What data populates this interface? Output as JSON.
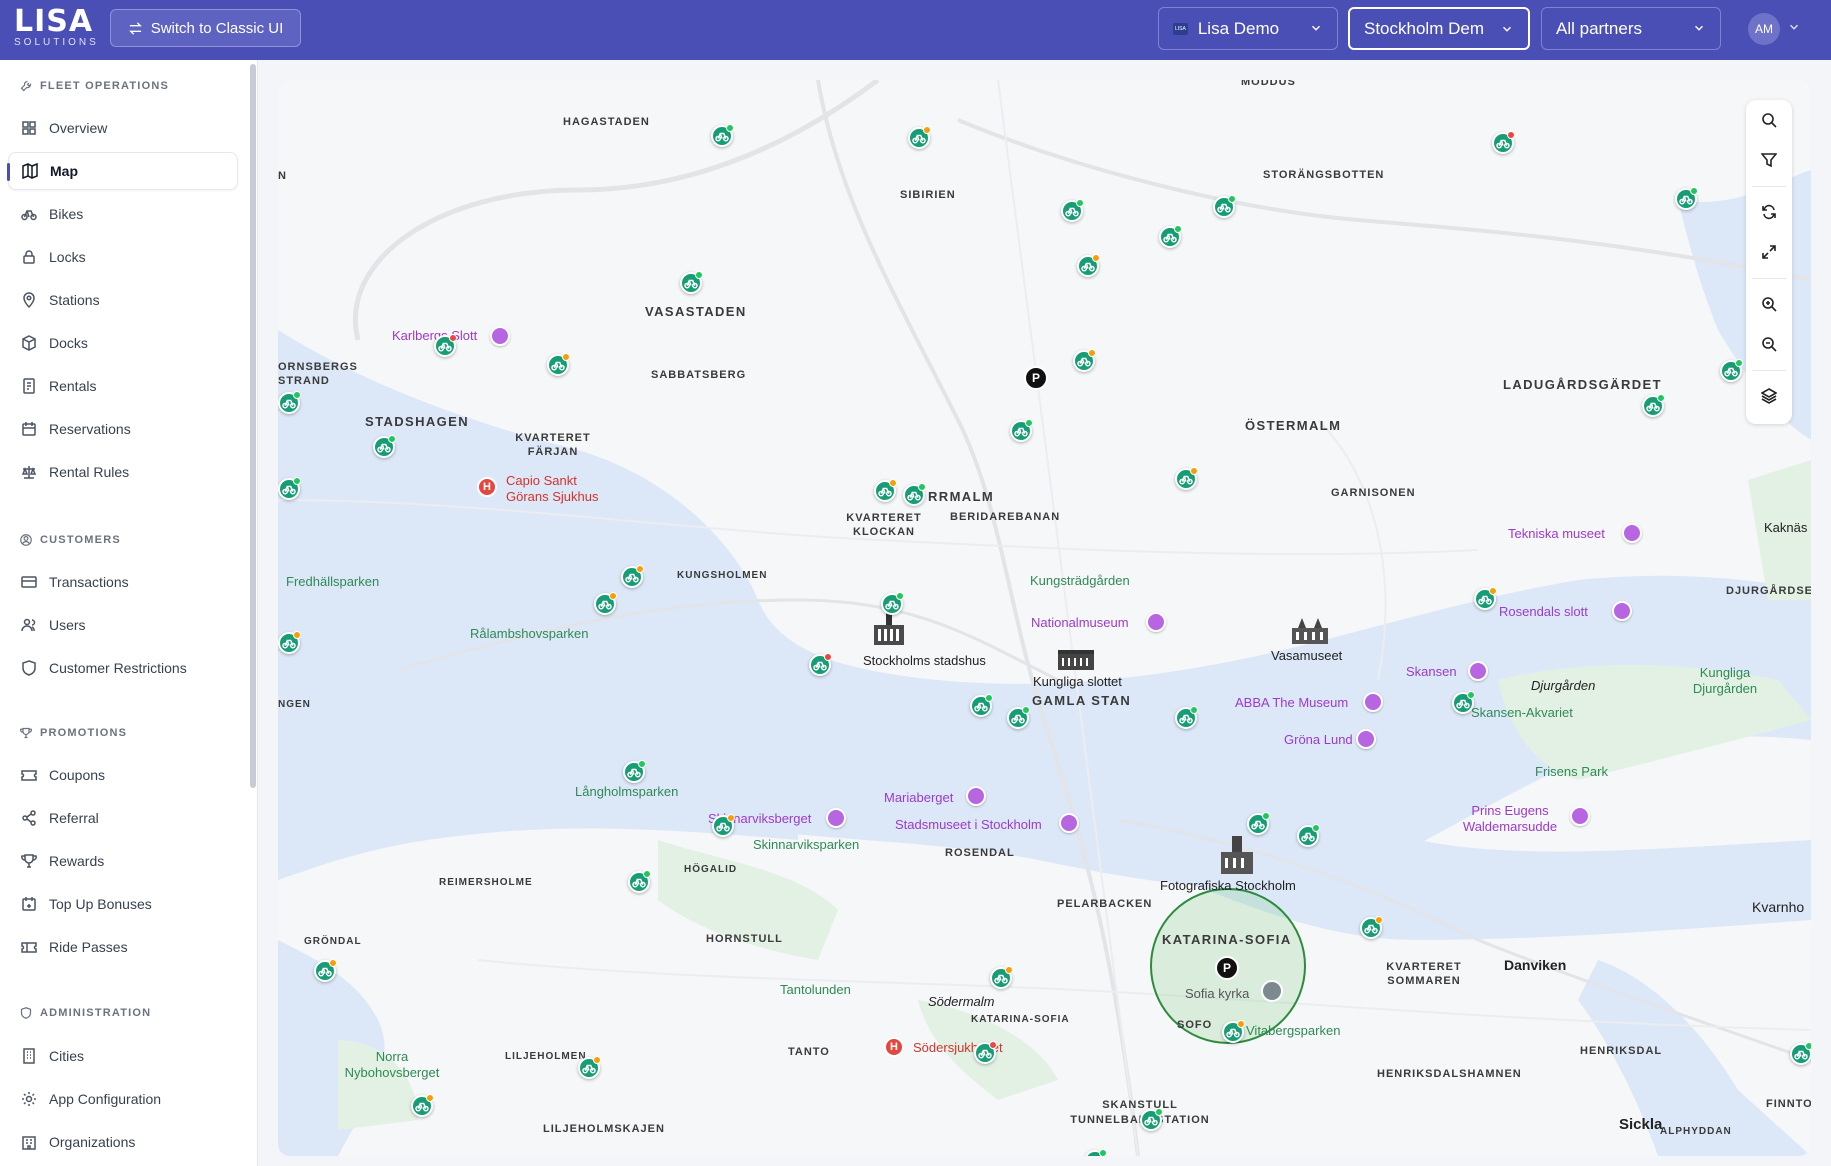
{
  "header": {
    "logo_main": "LISA",
    "logo_sub": "SOLUTIONS",
    "classic_button": "Switch to Classic UI",
    "org_select": {
      "value": "Lisa Demo",
      "badge": "LISA"
    },
    "city_select": {
      "value": "Stockholm Dem"
    },
    "partner_select": {
      "value": "All partners"
    },
    "avatar": "AM"
  },
  "sidebar": {
    "fleet_operations": "FLEET OPERATIONS",
    "fleet_items": [
      "Overview",
      "Map",
      "Bikes",
      "Locks",
      "Stations",
      "Docks",
      "Rentals",
      "Reservations",
      "Rental Rules"
    ],
    "customers": "CUSTOMERS",
    "customer_items": [
      "Transactions",
      "Users",
      "Customer Restrictions"
    ],
    "promotions": "PROMOTIONS",
    "promotion_items": [
      "Coupons",
      "Referral",
      "Rewards",
      "Top Up Bonuses",
      "Ride Passes"
    ],
    "administration": "ADMINISTRATION",
    "admin_items": [
      "Cities",
      "App Configuration",
      "Organizations"
    ],
    "active_item": "Map"
  },
  "map": {
    "districts": [
      "MODDUS",
      "HAGASTADEN",
      "SIBIRIEN",
      "STORÄNGSBOTTEN",
      "N",
      "VASASTADEN",
      "SABBATSBERG",
      "LADUGÅRDSGÄRDET",
      "ORNSBERGS STRAND",
      "STADSHAGEN",
      "KVARTERET FÄRJAN",
      "ÖSTERMALM",
      "RRMALM",
      "BERIDAREBANAN",
      "KVARTERET KLOCKAN",
      "GARNISONEN",
      "KUNGSHOLMEN",
      "DJURGÅRDSE",
      "GAMLA STAN",
      "NGEN",
      "ROSENDAL",
      "REIMERSHOLME",
      "HÖGALID",
      "PELARBACKEN",
      "KATARINA-SOFIA",
      "GRÖNDAL",
      "HORNSTULL",
      "KVARTERET SOMMAREN",
      "KATARINA-SOFIA",
      "SOFO",
      "TANTO",
      "LILJEHOLMEN",
      "HENRIKSDALSHAMNEN",
      "HENRIKSDAL",
      "FINNTO",
      "SKANSTULL TUNNELBANESTATION",
      "LILJEHOLMSKAJEN",
      "ALPHYDDAN"
    ],
    "parks": [
      "Fredhällsparken",
      "Kungsträdgården",
      "Rålambshovsparken",
      "Långholmsparken",
      "Skinnarviksparken",
      "Tantolunden",
      "Norra Nybohovsberget",
      "Frisens Park",
      "Skansen-Akvariet",
      "Vitabergsparken"
    ],
    "pois": [
      "Karlbergs Slott",
      "Tekniska museet",
      "Rosendals slott",
      "Nationalmuseum",
      "Skansen",
      "ABBA The Museum",
      "Gröna Lund",
      "Skinnarviksberget",
      "Mariaberget",
      "Stadsmuseet i Stockholm",
      "Prins Eugens Waldemarsudde"
    ],
    "hospitals": [
      "Capio Sankt Görans Sjukhus",
      "Södersjukhuset"
    ],
    "plain": [
      "Stockholms stadshus",
      "Kungliga slottet",
      "Vasamuseet",
      "Fotografiska Stockholm",
      "Sofia kyrka",
      "Kaknäs",
      "Kvarnho",
      "Danviken",
      "Sickla",
      "Kungliga Djurgården"
    ],
    "italic": [
      "Djurgården",
      "Södermalm"
    ],
    "parking_label": "P",
    "hospital_label": "H"
  },
  "icons": {
    "search": "search-icon",
    "filter": "filter-icon",
    "refresh": "refresh-icon",
    "expand": "expand-icon",
    "zoom_in": "zoom-in-icon",
    "zoom_out": "zoom-out-icon",
    "layers": "layers-icon"
  }
}
